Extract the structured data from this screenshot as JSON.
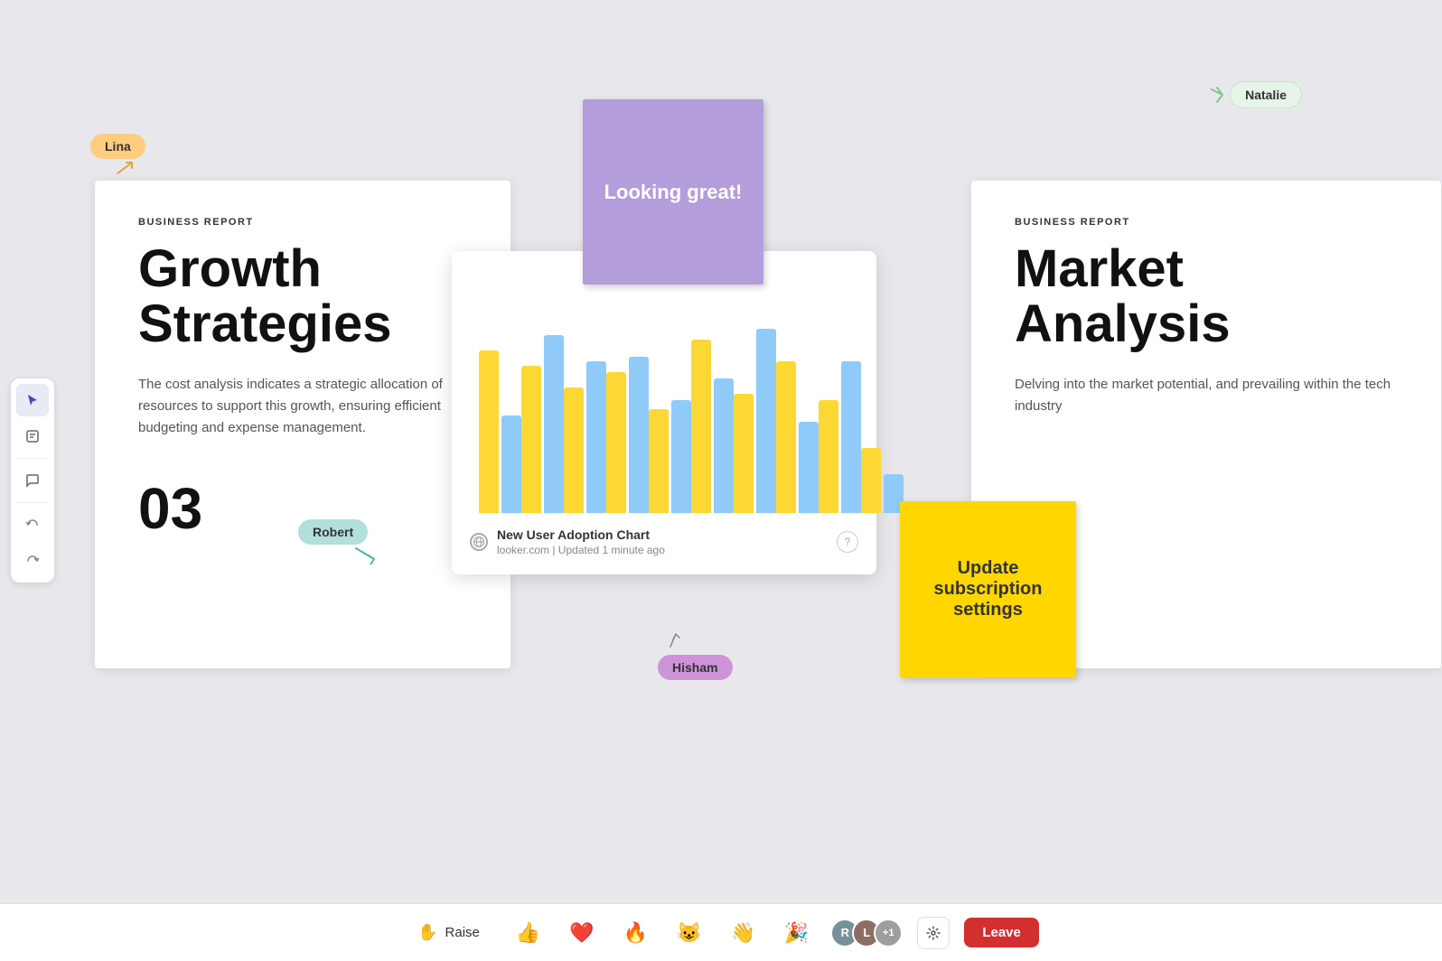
{
  "canvas": {
    "background": "#e8e8ec"
  },
  "toolbar": {
    "buttons": [
      {
        "id": "cursor",
        "icon": "▲",
        "label": "Cursor tool",
        "active": true
      },
      {
        "id": "note",
        "icon": "☐",
        "label": "Note tool",
        "active": false
      },
      {
        "id": "comment",
        "icon": "☐",
        "label": "Comment tool",
        "active": false
      }
    ]
  },
  "doc_left": {
    "label": "BUSINESS REPORT",
    "title": "Growth Strategies",
    "body": "The cost analysis indicates a strategic allocation of resources to support this growth, ensuring efficient budgeting and expense management.",
    "number": "03"
  },
  "doc_right": {
    "label": "BUSINESS REPORT",
    "title": "Market Analysis",
    "body": "Delving into the market potential, and prevailing within the tech industry"
  },
  "chart": {
    "title": "New User Adoption Chart",
    "source": "looker.com",
    "updated": "Updated 1 minute ago",
    "subtitle_full": "looker.com | Updated 1 minute ago",
    "bars": [
      {
        "yellow": 75,
        "blue": 45
      },
      {
        "yellow": 68,
        "blue": 82
      },
      {
        "yellow": 58,
        "blue": 70
      },
      {
        "yellow": 65,
        "blue": 72
      },
      {
        "yellow": 48,
        "blue": 52
      },
      {
        "yellow": 80,
        "blue": 62
      },
      {
        "yellow": 55,
        "blue": 85
      },
      {
        "yellow": 70,
        "blue": 42
      },
      {
        "yellow": 52,
        "blue": 70
      },
      {
        "yellow": 30,
        "blue": 18
      }
    ]
  },
  "sticky_purple": {
    "text": "Looking great!"
  },
  "sticky_yellow": {
    "text": "Update subscription settings"
  },
  "cursors": {
    "lina": {
      "name": "Lina",
      "color": "#ffcc80"
    },
    "natalie": {
      "name": "Natalie",
      "color": "#e8f5e9"
    },
    "robert": {
      "name": "Robert",
      "color": "#b2dfdb"
    },
    "hisham": {
      "name": "Hisham",
      "color": "#ce93d8"
    }
  },
  "bottom_bar": {
    "raise_label": "Raise",
    "reactions": [
      "👍",
      "❤️",
      "🔥",
      "😺",
      "👋",
      "🎉"
    ],
    "leave_label": "Leave",
    "participants_extra": "+1"
  }
}
